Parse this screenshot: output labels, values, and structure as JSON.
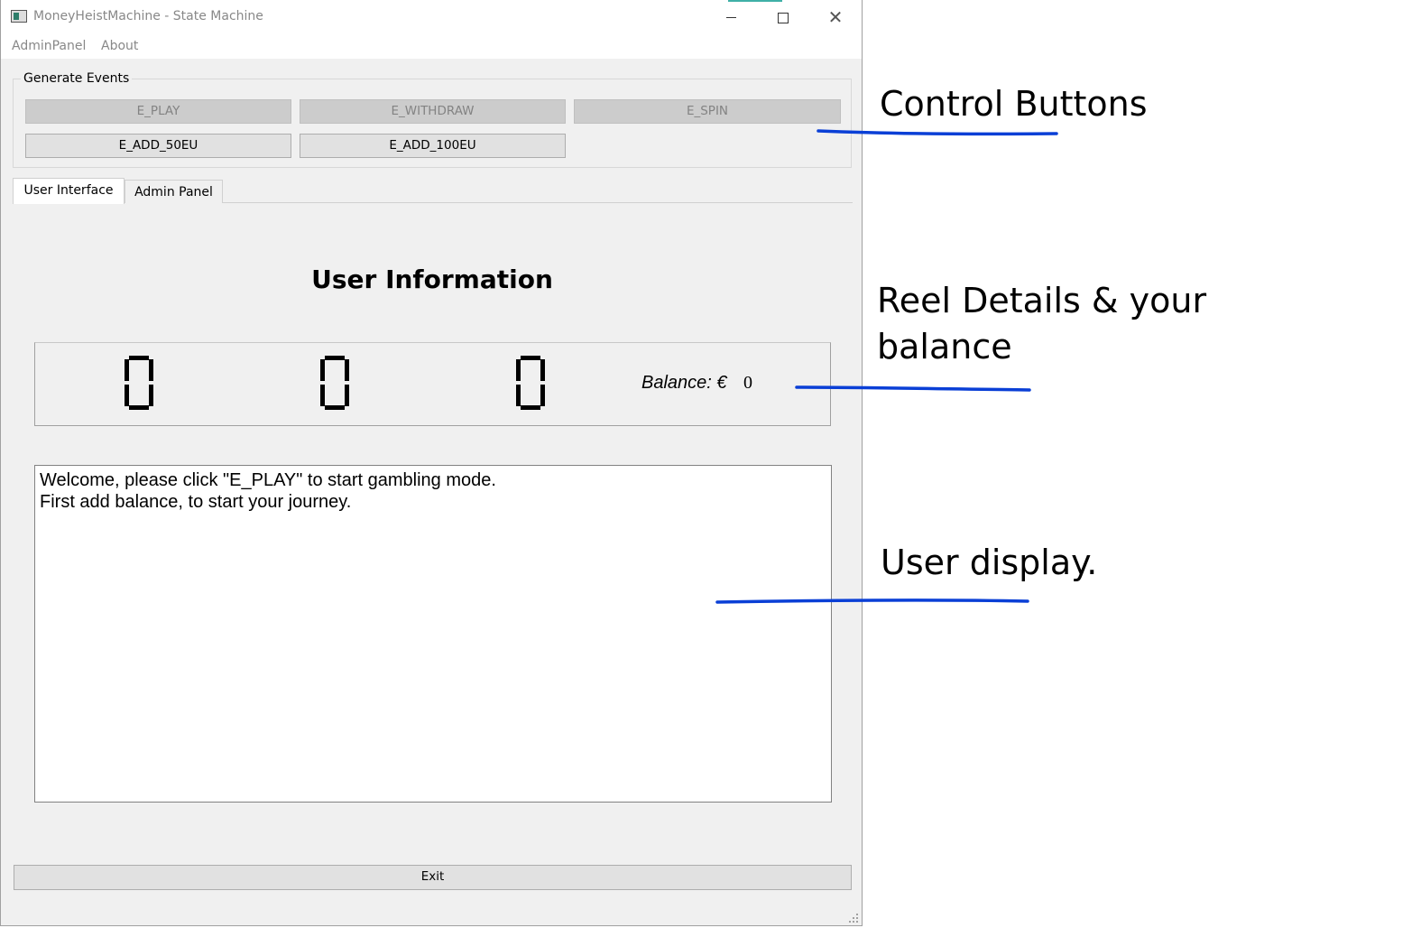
{
  "window": {
    "title": "MoneyHeistMachine - State Machine",
    "minimize_glyph": "",
    "close_glyph": "✕"
  },
  "menu": {
    "items": [
      "AdminPanel",
      "About"
    ]
  },
  "events_group": {
    "title": "Generate Events",
    "buttons": [
      {
        "label": "E_PLAY",
        "enabled": false
      },
      {
        "label": "E_WITHDRAW",
        "enabled": false
      },
      {
        "label": "E_SPIN",
        "enabled": false
      },
      {
        "label": "E_ADD_50EU",
        "enabled": true
      },
      {
        "label": "E_ADD_100EU",
        "enabled": true
      }
    ]
  },
  "tabs": [
    {
      "label": "User Interface",
      "active": true
    },
    {
      "label": "Admin Panel",
      "active": false
    }
  ],
  "user_info": {
    "title": "User Information",
    "reels": [
      "0",
      "0",
      "0"
    ],
    "balance_label": "Balance: €",
    "balance_value": "0"
  },
  "display": {
    "lines": [
      "Welcome, please click \"E_PLAY\" to start gambling mode.",
      "First add balance, to start your journey."
    ]
  },
  "exit_label": "Exit",
  "annotations": {
    "control_buttons": "Control Buttons",
    "reel_details_line1": "Reel Details & your",
    "reel_details_line2": "balance",
    "user_display": "User display."
  },
  "colors": {
    "annotation_line": "#0a3fd6",
    "window_bg": "#f0f0f0",
    "title_accent": "#3fb0a7"
  }
}
